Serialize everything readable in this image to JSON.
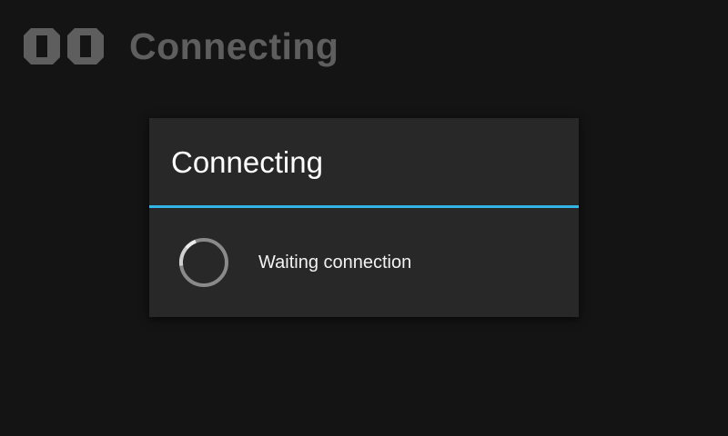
{
  "app": {
    "title": "Connecting",
    "logo_icon": "double-d-logo-icon"
  },
  "dialog": {
    "title": "Connecting",
    "message": "Waiting connection",
    "spinner_icon": "progress-spinner-icon",
    "divider_color": "#33b5e5"
  },
  "colors": {
    "background": "#141414",
    "dialog_background": "#282828",
    "app_title": "#5e5e5e",
    "accent": "#33b5e5"
  }
}
